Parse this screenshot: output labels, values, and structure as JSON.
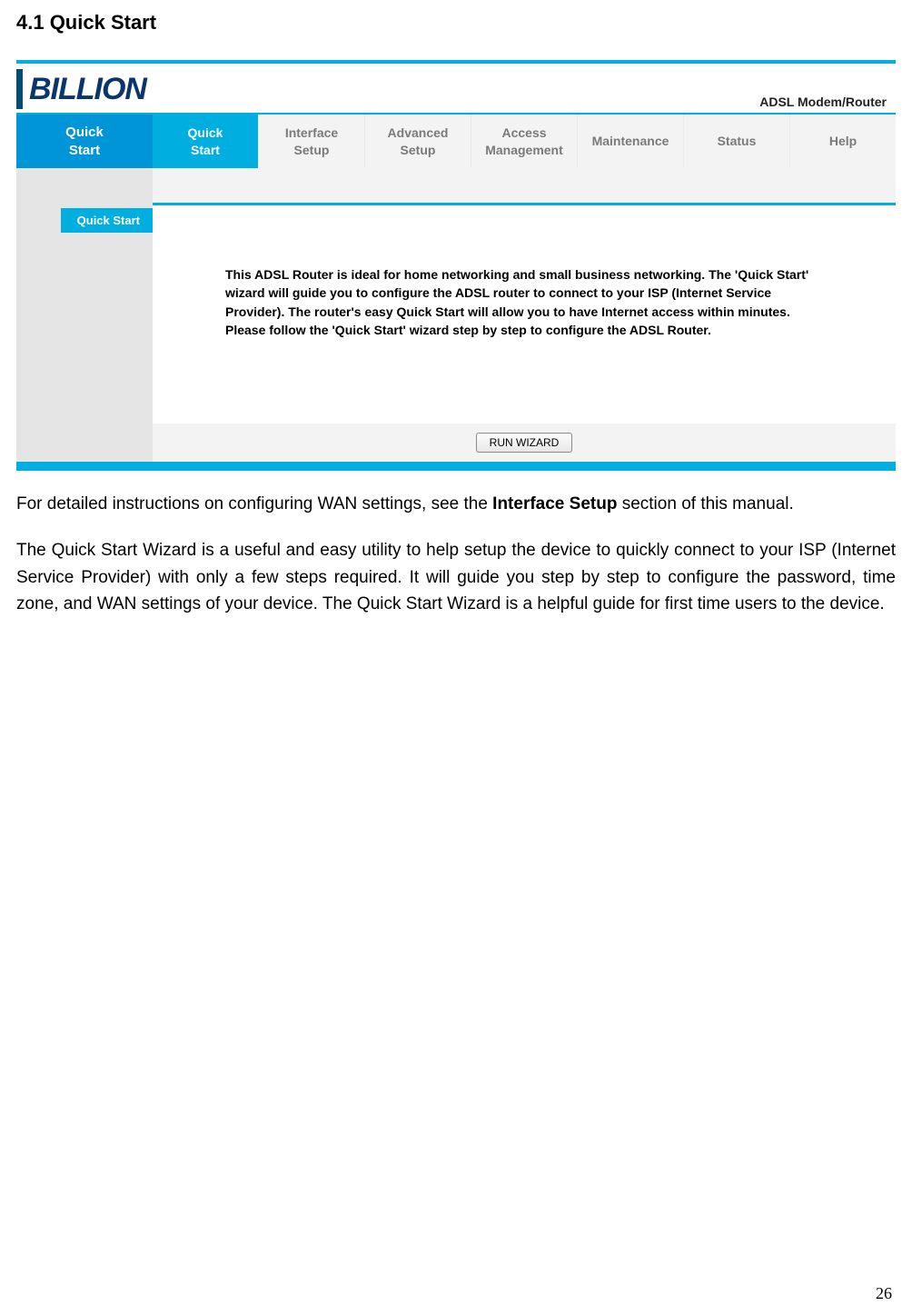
{
  "doc": {
    "section_heading": "4.1 Quick Start",
    "para1_prefix": "For detailed instructions on configuring WAN settings, see the ",
    "para1_bold": "Interface Setup",
    "para1_suffix": " section of this manual.",
    "para2": "The Quick Start Wizard is a useful and easy utility to help setup the device to quickly connect to your ISP (Internet Service Provider) with only a few steps required. It will guide you step by step to configure the password, time zone, and WAN settings of your device. The Quick Start Wizard is a helpful guide for first time users to the device.",
    "page_number": "26"
  },
  "router_ui": {
    "brand": "BILLION",
    "product_label": "ADSL Modem/Router",
    "side_title": "Quick\nStart",
    "tabs": [
      {
        "label": "Quick\nStart",
        "active": true
      },
      {
        "label": "Interface\nSetup",
        "active": false
      },
      {
        "label": "Advanced\nSetup",
        "active": false
      },
      {
        "label": "Access\nManagement",
        "active": false
      },
      {
        "label": "Maintenance",
        "active": false
      },
      {
        "label": "Status",
        "active": false
      },
      {
        "label": "Help",
        "active": false
      }
    ],
    "submenu_badge": "Quick Start",
    "content_text": "This ADSL Router is ideal for home networking and small business networking. The 'Quick Start' wizard will guide you to configure the ADSL router to connect to your ISP (Internet Service Provider). The router's easy Quick Start will allow you to have Internet access within minutes. Please follow the 'Quick Start' wizard step by step to configure the ADSL Router.",
    "wizard_button": "RUN WIZARD"
  }
}
